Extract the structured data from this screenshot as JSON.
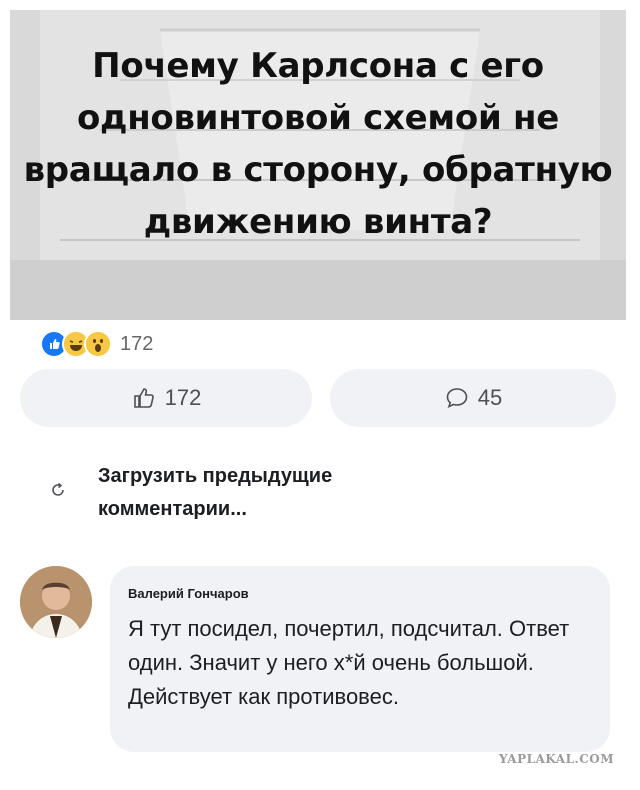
{
  "post": {
    "title": "Почему Карлсона с его одновинтовой схемой не вращало в сторону, обратную движению винта?"
  },
  "reactions": {
    "types": [
      "like-icon",
      "haha-icon",
      "wow-icon"
    ],
    "count": "172"
  },
  "actions": {
    "like_count": "172",
    "comment_count": "45"
  },
  "load_previous": {
    "label": "Загрузить предыдущие комментарии..."
  },
  "comment": {
    "author": "Валерий Гончаров",
    "text": "Я тут посидел, почертил, подсчитал. Ответ один. Значит у него х*й очень большой. Действует как противовес."
  },
  "watermark": "YAPLAKAL.COM",
  "colors": {
    "like_blue": "#1877f2",
    "emoji_yellow": "#f7c843",
    "bubble_bg": "#f0f2f5",
    "text": "#1c1e21",
    "muted": "#65676b"
  }
}
